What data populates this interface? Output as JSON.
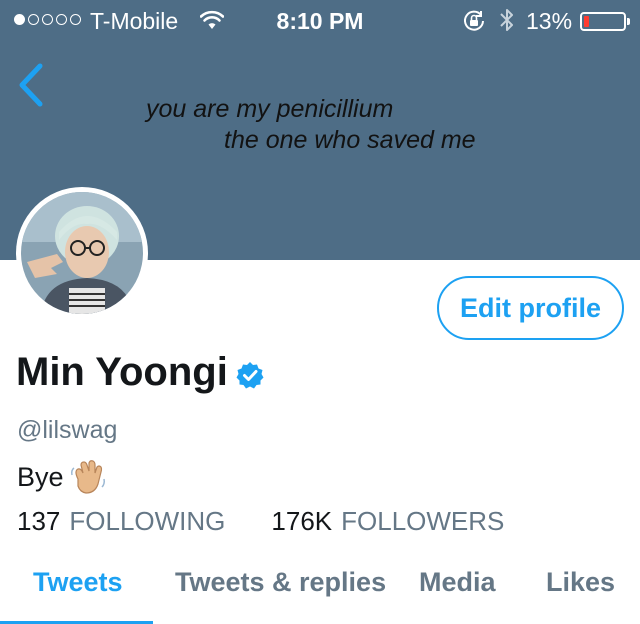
{
  "status_bar": {
    "signal_dots_filled": 1,
    "signal_dots_total": 5,
    "carrier": "T-Mobile",
    "time": "8:10 PM",
    "battery_percent": "13%",
    "battery_level": 0.13,
    "icons": [
      "wifi-icon",
      "rotation-lock-icon",
      "bluetooth-icon",
      "battery-icon"
    ]
  },
  "header": {
    "back_icon": "chevron-left-icon",
    "banner_line1": "you are my penicillium",
    "banner_line2": "the one who saved me",
    "banner_color": "#4e6d86"
  },
  "profile": {
    "display_name": "Min Yoongi",
    "verified_icon": "verified-badge-icon",
    "handle": "@lilswag",
    "bio_text": "Bye",
    "bio_emoji_icon": "waving-hand-icon",
    "edit_profile_label": "Edit profile"
  },
  "stats": {
    "following_count": "137",
    "following_label": "FOLLOWING",
    "followers_count": "176K",
    "followers_label": "FOLLOWERS"
  },
  "tabs": [
    {
      "label": "Tweets",
      "active": true
    },
    {
      "label": "Tweets & replies",
      "active": false
    },
    {
      "label": "Media",
      "active": false
    },
    {
      "label": "Likes",
      "active": false
    }
  ],
  "colors": {
    "accent": "#1da1f2",
    "muted": "#657786",
    "text": "#14171a",
    "battery_low": "#ff3b30"
  }
}
